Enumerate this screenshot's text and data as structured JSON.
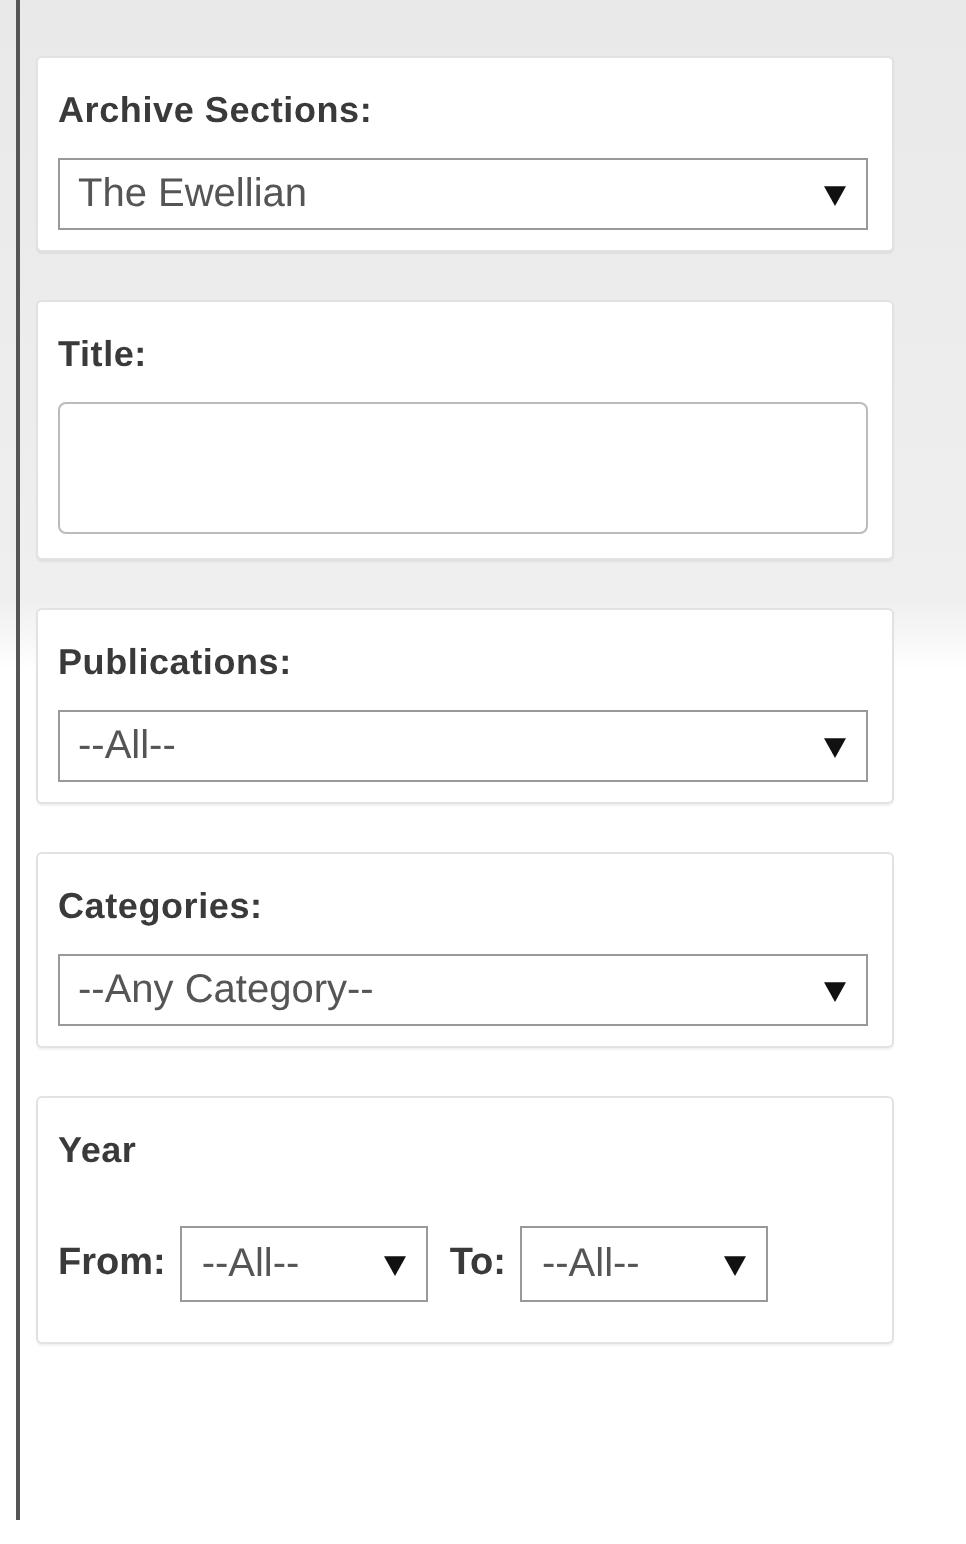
{
  "sections": [
    {
      "kind": "select",
      "label": "Archive Sections:",
      "value": "The Ewellian"
    },
    {
      "kind": "text",
      "label": "Title:"
    },
    {
      "kind": "select",
      "label": "Publications:",
      "value": "--All--"
    },
    {
      "kind": "select",
      "label": "Categories:",
      "value": "--Any Category--"
    },
    {
      "kind": "range",
      "label": "Year",
      "from": {
        "label": "From:",
        "value": "--All--"
      },
      "to": {
        "label": "To:",
        "value": "--All--"
      }
    }
  ]
}
